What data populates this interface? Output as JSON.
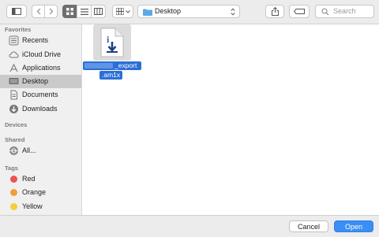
{
  "toolbar": {
    "location_label": "Desktop",
    "search_placeholder": "Search"
  },
  "sidebar": {
    "favorites_header": "Favorites",
    "favorites": [
      {
        "label": "Recents",
        "icon": "recents-icon"
      },
      {
        "label": "iCloud Drive",
        "icon": "cloud-icon"
      },
      {
        "label": "Applications",
        "icon": "applications-icon"
      },
      {
        "label": "Desktop",
        "icon": "desktop-icon",
        "selected": true
      },
      {
        "label": "Documents",
        "icon": "document-icon"
      },
      {
        "label": "Downloads",
        "icon": "download-icon"
      }
    ],
    "devices_header": "Devices",
    "shared_header": "Shared",
    "shared": [
      {
        "label": "All...",
        "icon": "network-icon"
      }
    ],
    "tags_header": "Tags",
    "tags": [
      {
        "label": "Red",
        "color": "#f0524f"
      },
      {
        "label": "Orange",
        "color": "#f59b3c"
      },
      {
        "label": "Yellow",
        "color": "#f5cd3c"
      }
    ]
  },
  "file": {
    "name_line1": "_export",
    "name_line2": ".am1x"
  },
  "footer": {
    "cancel_label": "Cancel",
    "open_label": "Open"
  },
  "colors": {
    "selection": "#2b6fd6",
    "primary_button": "#3b8ef5"
  }
}
